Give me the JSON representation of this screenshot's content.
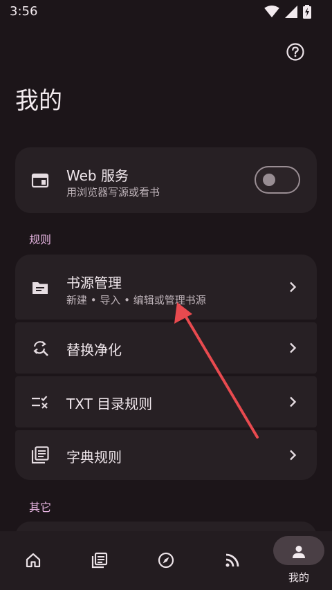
{
  "status_bar": {
    "time": "3:56",
    "icons": [
      "wifi-icon",
      "signal-icon",
      "battery-charging-icon"
    ]
  },
  "header": {
    "title": "我的",
    "help_icon": "help-circle-icon"
  },
  "web_service": {
    "title": "Web 服务",
    "subtitle": "用浏览器写源或看书",
    "icon": "web-window-icon",
    "enabled": false
  },
  "sections": {
    "rules": {
      "label": "规则",
      "items": [
        {
          "title": "书源管理",
          "subtitle": "新建 • 导入 • 编辑或管理书源",
          "icon": "folder-icon"
        },
        {
          "title": "替换净化",
          "icon": "find-replace-icon"
        },
        {
          "title": "TXT 目录规则",
          "icon": "toc-rule-icon"
        },
        {
          "title": "字典规则",
          "icon": "dictionary-icon"
        }
      ]
    },
    "other": {
      "label": "其它"
    }
  },
  "bottom_nav": {
    "items": [
      {
        "icon": "home-icon"
      },
      {
        "icon": "bookshelf-icon"
      },
      {
        "icon": "compass-icon"
      },
      {
        "icon": "rss-icon"
      },
      {
        "icon": "person-icon",
        "label": "我的",
        "active": true
      }
    ]
  },
  "colors": {
    "background": "#1c1519",
    "card": "#272024",
    "accent": "#e8b6e3",
    "annotation_arrow": "#e84a4f"
  }
}
